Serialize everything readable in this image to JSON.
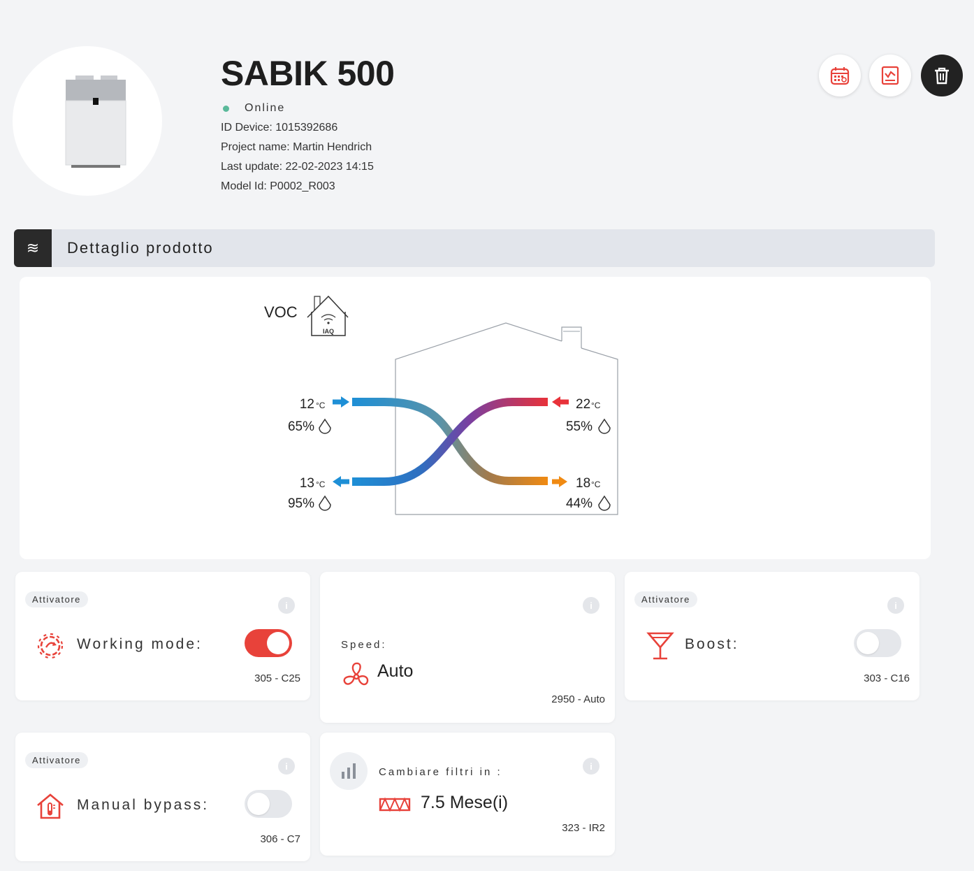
{
  "header": {
    "title": "SABIK 500",
    "status": "Online",
    "device_id": "ID Device: 1015392686",
    "project": "Project name: Martin Hendrich",
    "last_update": "Last update: 22-02-2023 14:15",
    "model": "Model Id: P0002_R003",
    "actions": [
      "calendar-icon",
      "chart-report-icon",
      "trash-icon"
    ]
  },
  "section": {
    "title": "Dettaglio prodotto",
    "icon": "waves-icon"
  },
  "diagram": {
    "voc_label": "VOC",
    "iaq_label": "IAQ",
    "outdoor_in": {
      "temp": "12",
      "unit": "°C",
      "humidity": "65%"
    },
    "outdoor_out": {
      "temp": "13",
      "unit": "°C",
      "humidity": "95%"
    },
    "indoor_extract": {
      "temp": "22",
      "unit": "°C",
      "humidity": "55%"
    },
    "indoor_supply": {
      "temp": "18",
      "unit": "°C",
      "humidity": "44%"
    }
  },
  "cards": {
    "working_mode": {
      "chip": "Attivatore",
      "label": "Working mode:",
      "code": "305 - C25",
      "enabled": true
    },
    "speed": {
      "label": "Speed:",
      "value": "Auto",
      "code": "2950 - Auto"
    },
    "boost": {
      "chip": "Attivatore",
      "label": "Boost:",
      "code": "303 - C16",
      "enabled": false
    },
    "bypass": {
      "chip": "Attivatore",
      "label": "Manual bypass:",
      "code": "306 - C7",
      "enabled": false
    },
    "filters": {
      "label": "Cambiare filtri in :",
      "value": "7.5 Mese(i)",
      "code": "323 - IR2"
    }
  },
  "colors": {
    "accent": "#e8423a",
    "cold": "#1e8fd6",
    "warm": "#f08a12",
    "online": "#5ab99a"
  }
}
